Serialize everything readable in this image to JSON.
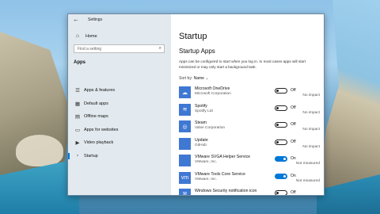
{
  "window": {
    "title": "Settings",
    "back_glyph": "←",
    "controls": {
      "minimize": "—",
      "maximize": "☐",
      "close": "✕"
    }
  },
  "sidebar": {
    "home_label": "Home",
    "search_placeholder": "Find a setting",
    "section": "Apps",
    "items": [
      {
        "label": "Apps & features",
        "icon": "apps-list-icon",
        "glyph": "☰",
        "active": false
      },
      {
        "label": "Default apps",
        "icon": "default-apps-icon",
        "glyph": "▦",
        "active": false
      },
      {
        "label": "Offline maps",
        "icon": "map-icon",
        "glyph": "▤",
        "active": false
      },
      {
        "label": "Apps for websites",
        "icon": "website-icon",
        "glyph": "▭",
        "active": false
      },
      {
        "label": "Video playback",
        "icon": "video-icon",
        "glyph": "▶",
        "active": false
      },
      {
        "label": "Startup",
        "icon": "startup-icon",
        "glyph": "▫",
        "active": true
      }
    ]
  },
  "main": {
    "title": "Startup",
    "subtitle": "Startup Apps",
    "description": "Apps can be configured to start when you log in. In most cases apps will start minimized or may only start a background task.",
    "sort_label": "Sort by:",
    "sort_value": "Name",
    "sort_chevron": "⌄",
    "apps": [
      {
        "name": "Microsoft OneDrive",
        "publisher": "Microsoft Corporation",
        "state": "Off",
        "impact": "No impact",
        "on": false,
        "icon": "onedrive-icon",
        "glyph": "☁"
      },
      {
        "name": "Spotify",
        "publisher": "Spotify Ltd",
        "state": "Off",
        "impact": "No impact",
        "on": false,
        "icon": "spotify-icon",
        "glyph": "≋"
      },
      {
        "name": "Steam",
        "publisher": "Valve Corporation",
        "state": "Off",
        "impact": "No impact",
        "on": false,
        "icon": "steam-icon",
        "glyph": "◎"
      },
      {
        "name": "Update",
        "publisher": "GitHub",
        "state": "Off",
        "impact": "No impact",
        "on": false,
        "icon": "update-icon",
        "glyph": ""
      },
      {
        "name": "VMware SVGA Helper Service",
        "publisher": "VMware, Inc.",
        "state": "On",
        "impact": "Not measured",
        "on": true,
        "icon": "vmware-svga-icon",
        "glyph": ""
      },
      {
        "name": "VMware Tools Core Service",
        "publisher": "VMware, Inc.",
        "state": "On",
        "impact": "Not measured",
        "on": true,
        "icon": "vmware-tools-icon",
        "glyph": "vm"
      },
      {
        "name": "Windows Security notification icon",
        "publisher": "",
        "state": "Off",
        "impact": "",
        "on": false,
        "icon": "windows-security-icon",
        "glyph": "⛨"
      }
    ]
  },
  "colors": {
    "accent": "#0078d7",
    "app_icon_bg": "#3f78d3"
  }
}
